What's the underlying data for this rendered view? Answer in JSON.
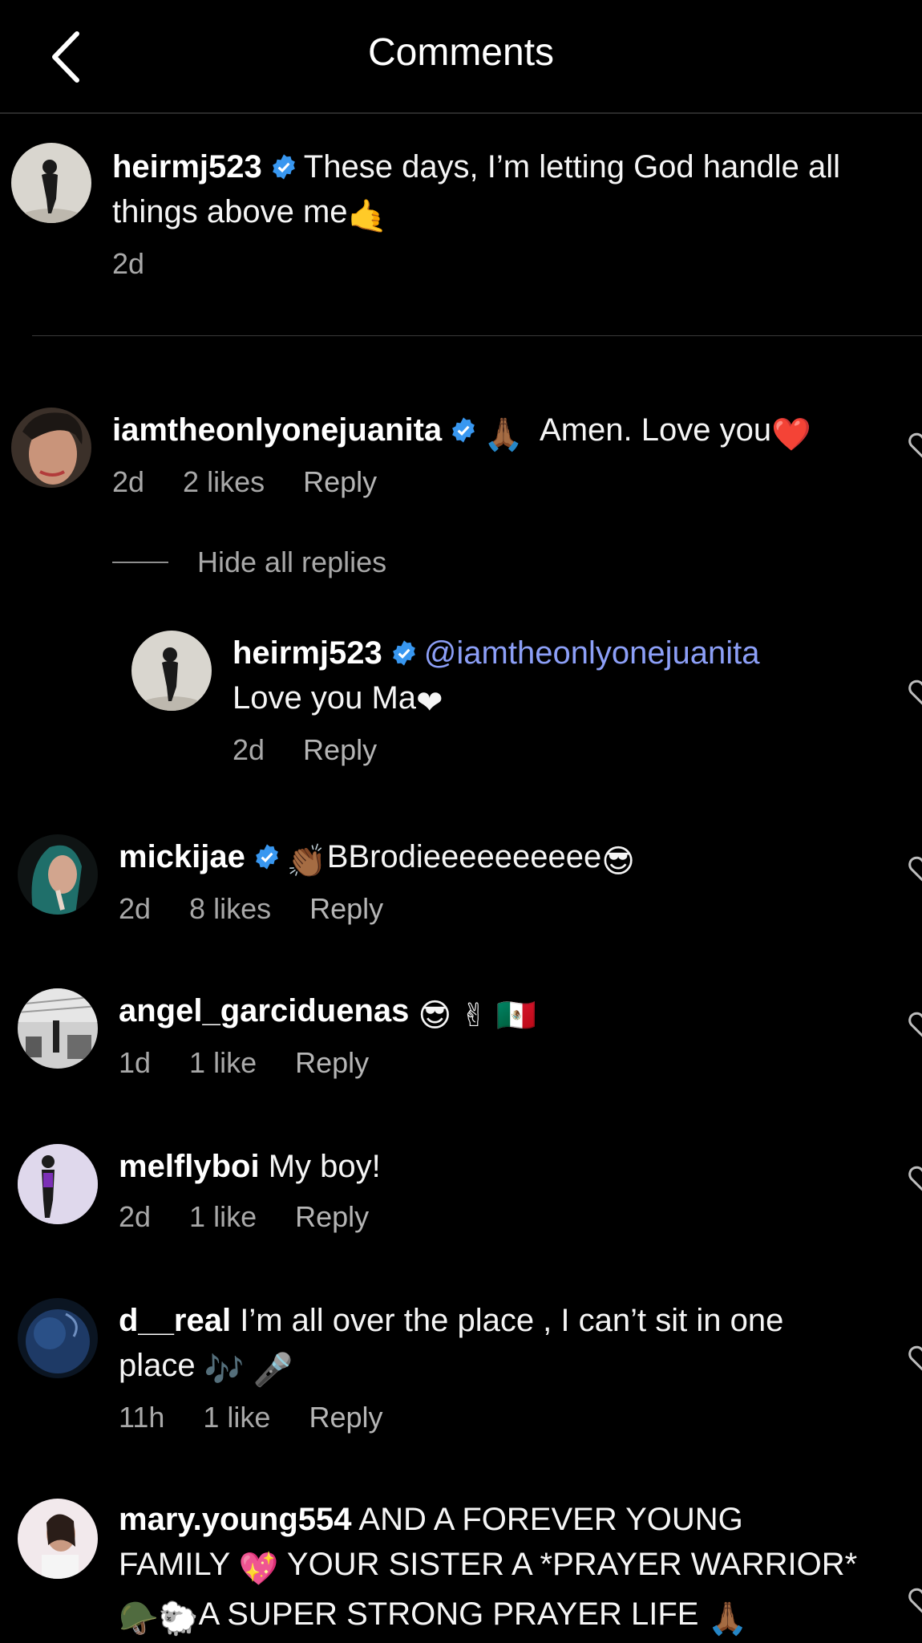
{
  "header": {
    "title": "Comments"
  },
  "caption": {
    "username": "heirmj523",
    "text_line1": "These days, I’m letting God handle all",
    "text_line2": "things above me",
    "emoji": "🤙",
    "time": "2d"
  },
  "comments": [
    {
      "username": "iamtheonlyonejuanita",
      "verified": true,
      "emoji_prefix": "🙏🏾",
      "text": "Amen. Love you",
      "emoji_suffix": "❤️",
      "time": "2d",
      "likes": "2 likes",
      "reply": "Reply"
    },
    {
      "username": "mickijae",
      "verified": true,
      "emoji_prefix": "👏🏾",
      "text": "BBrodieeeeeeeeee",
      "emoji_suffix": "😎",
      "time": "2d",
      "likes": "8 likes",
      "reply": "Reply"
    },
    {
      "username": "angel_garciduenas",
      "verified": false,
      "text": "",
      "emoji_suffix": "😎 ✌ 🇲🇽",
      "time": "1d",
      "likes": "1 like",
      "reply": "Reply"
    },
    {
      "username": "melflyboi",
      "verified": false,
      "text": "My boy!",
      "time": "2d",
      "likes": "1 like",
      "reply": "Reply"
    },
    {
      "username": "d__real",
      "verified": false,
      "text_line1": "I’m all over the place , I can’t sit in one",
      "text_line2": "place",
      "emoji_suffix": "🎶 🎤",
      "time": "11h",
      "likes": "1 like",
      "reply": "Reply"
    },
    {
      "username": "mary.young554",
      "verified": false,
      "text_line1": "AND A FOREVER YOUNG",
      "text_line2_a": "FAMILY",
      "text_line2_emoji": "💖",
      "text_line2_b": "YOUR SISTER A *PRAYER WARRIOR*",
      "text_line3_emoji": "🪖🐑",
      "text_line3": "A SUPER STRONG PRAYER LIFE",
      "text_line3_end_emoji": "🙏🏾"
    }
  ],
  "thread": {
    "hide_replies": "Hide all replies",
    "reply": {
      "username": "heirmj523",
      "mention": "@iamtheonlyonejuanita",
      "text": "Love you Ma",
      "emoji": "❤",
      "time": "2d",
      "reply": "Reply"
    }
  },
  "colors": {
    "background": "#000000",
    "verified": "#3897f0",
    "mention": "#8c9ff7",
    "meta": "#a8a8a8"
  }
}
